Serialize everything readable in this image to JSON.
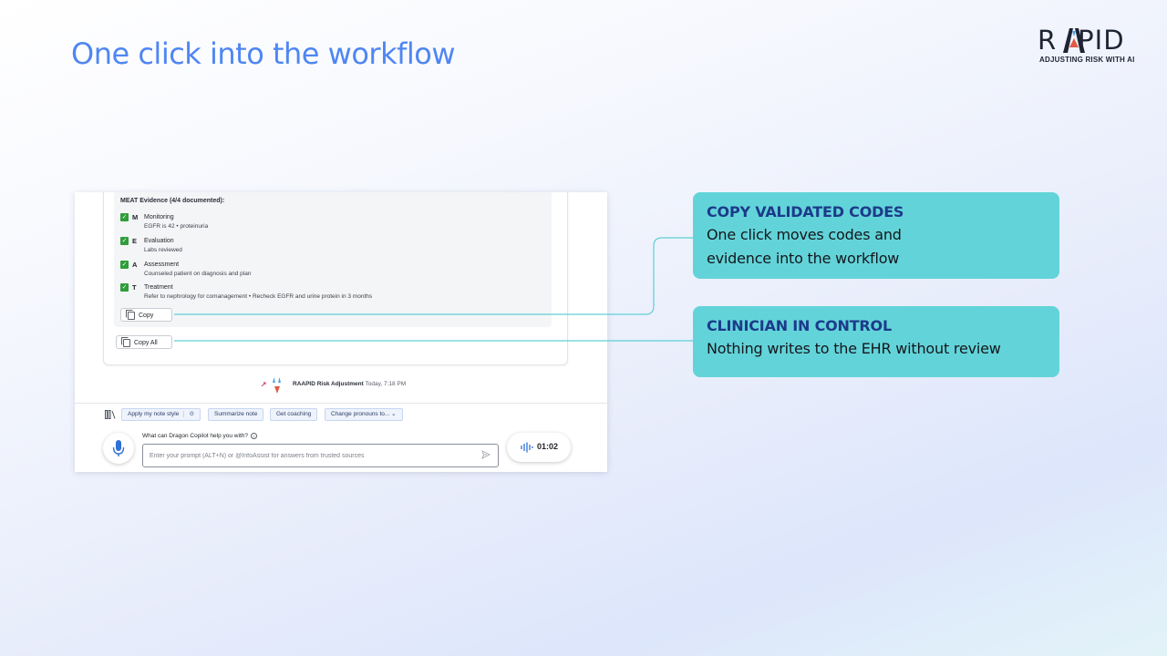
{
  "slide": {
    "title": "One click into the workflow"
  },
  "logo": {
    "word_left": "R",
    "word_right": "PID",
    "tagline": "ADJUSTING RISK WITH AI",
    "colors": {
      "blue": "#4da3e8",
      "red": "#e05a47",
      "dark": "#1e2433"
    }
  },
  "screenshot": {
    "meat_heading": "MEAT Evidence (4/4 documented):",
    "meat_items": [
      {
        "letter": "M",
        "title": "Monitoring",
        "detail": "EGFR is 42 • proteinuria"
      },
      {
        "letter": "E",
        "title": "Evaluation",
        "detail": "Labs reviewed"
      },
      {
        "letter": "A",
        "title": "Assessment",
        "detail": "Counseled patient on diagnosis and plan"
      },
      {
        "letter": "T",
        "title": "Treatment",
        "detail": "Refer to nephrology for comanagement • Recheck EGFR and urine protein in 3 months"
      }
    ],
    "copy_label": "Copy",
    "copy_all_label": "Copy All",
    "attribution": {
      "name": "RAAPID Risk Adjustment",
      "time": "Today, 7:18 PM"
    },
    "chips": {
      "note_style": "Apply my note style",
      "summarize": "Summarize note",
      "coaching": "Get coaching",
      "pronouns": "Change pronouns to..."
    },
    "prompt_label": "What can Dragon Copilot help you with?",
    "prompt_placeholder": "Enter your prompt (ALT+N) or @InfoAssist for answers from trusted sources",
    "timer": "01:02",
    "icons": [
      "check-icon",
      "copy-icon",
      "library-icon",
      "settings-icon",
      "chevron-down-icon",
      "microphone-icon",
      "info-icon",
      "send-icon",
      "waveform-icon"
    ]
  },
  "callouts": [
    {
      "heading": "COPY VALIDATED CODES",
      "body_line1": "One click moves codes and",
      "body_line2": "evidence into the workflow"
    },
    {
      "heading": "CLINICIAN IN CONTROL",
      "body_line1": "Nothing writes to the EHR without review"
    }
  ],
  "colors": {
    "title": "#4f86f2",
    "callout_bg": "#62d4d9",
    "callout_heading": "#1d3a8a",
    "connector": "#5ecfd6",
    "check": "#2f9d3a"
  }
}
